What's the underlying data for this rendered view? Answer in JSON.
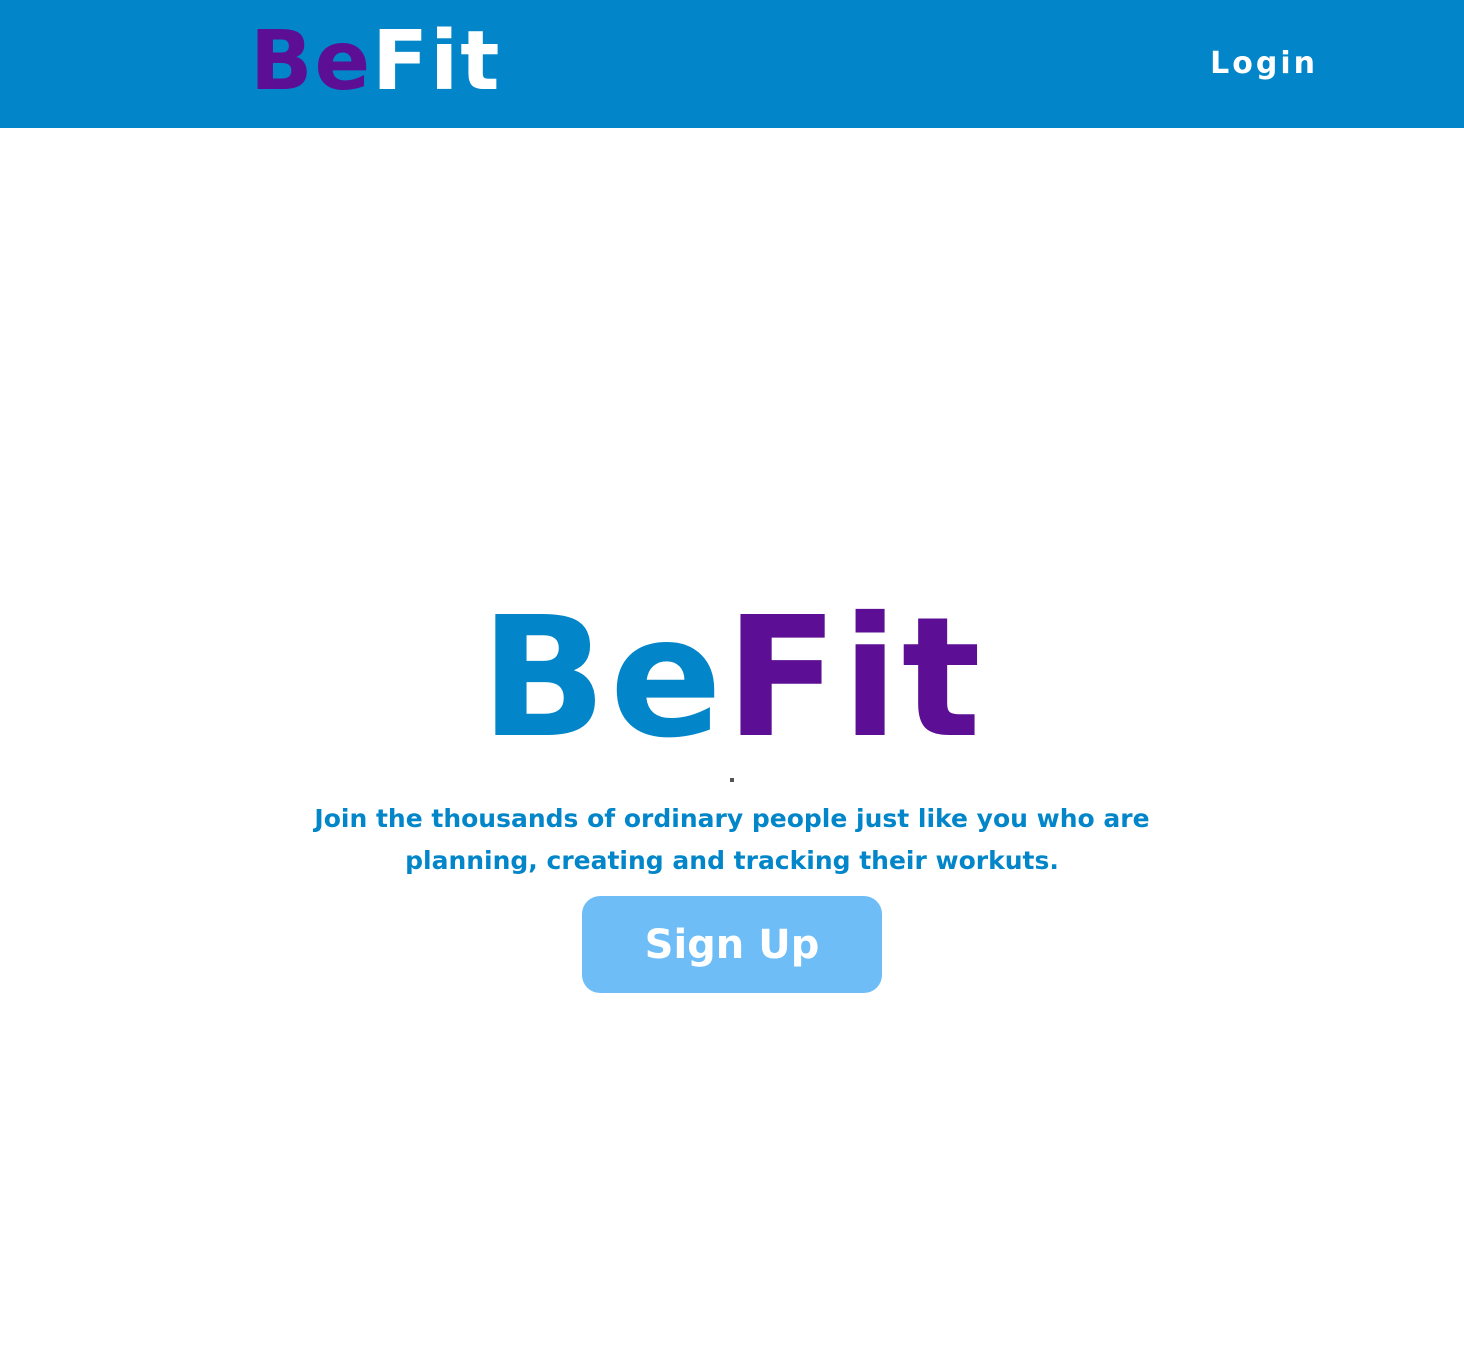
{
  "navbar": {
    "logo_part1": "Be",
    "logo_part2": "Fit",
    "login_label": "Login"
  },
  "hero": {
    "logo_part1": "Be",
    "logo_part2": "Fit",
    "tagline": "Join the thousands of ordinary people just like you who are planning, creating and tracking their workuts.",
    "signup_label": "Sign Up"
  },
  "colors": {
    "navbar_bg": "#0286c9",
    "brand_purple": "#5c0f94",
    "brand_blue": "#0286c9",
    "button_bg": "#6ebdf7"
  }
}
